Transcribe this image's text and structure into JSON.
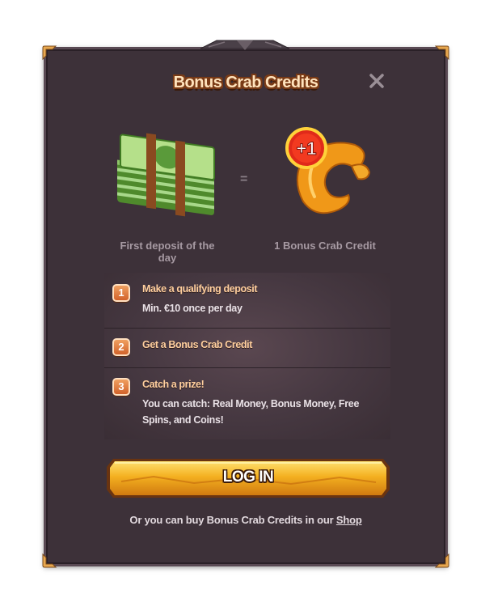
{
  "dialog": {
    "title": "Bonus Crab Credits",
    "close_icon": "close-icon"
  },
  "exchange": {
    "left_caption": "First deposit of the day",
    "equals": "=",
    "right_caption": "1 Bonus Crab Credit",
    "badge": "+1",
    "left_image": "cash-stack-icon",
    "right_image": "golden-claw-icon"
  },
  "steps": [
    {
      "number": "1",
      "title": "Make a qualifying deposit",
      "desc": "Min. €10 once per day"
    },
    {
      "number": "2",
      "title": "Get a Bonus Crab Credit",
      "desc": ""
    },
    {
      "number": "3",
      "title": "Catch a prize!",
      "desc": "You can catch: Real Money, Bonus Money, Free Spins, and Coins!"
    }
  ],
  "login_button": {
    "label": "LOG IN"
  },
  "footer": {
    "text": "Or you can buy Bonus Crab Credits in our ",
    "link": "Shop"
  },
  "colors": {
    "panel": "#3d3139",
    "title_fill": "#ffe3bd",
    "step_title": "#ffcf9e",
    "button_gold": "#f0a820",
    "badge_red": "#d8231a"
  }
}
